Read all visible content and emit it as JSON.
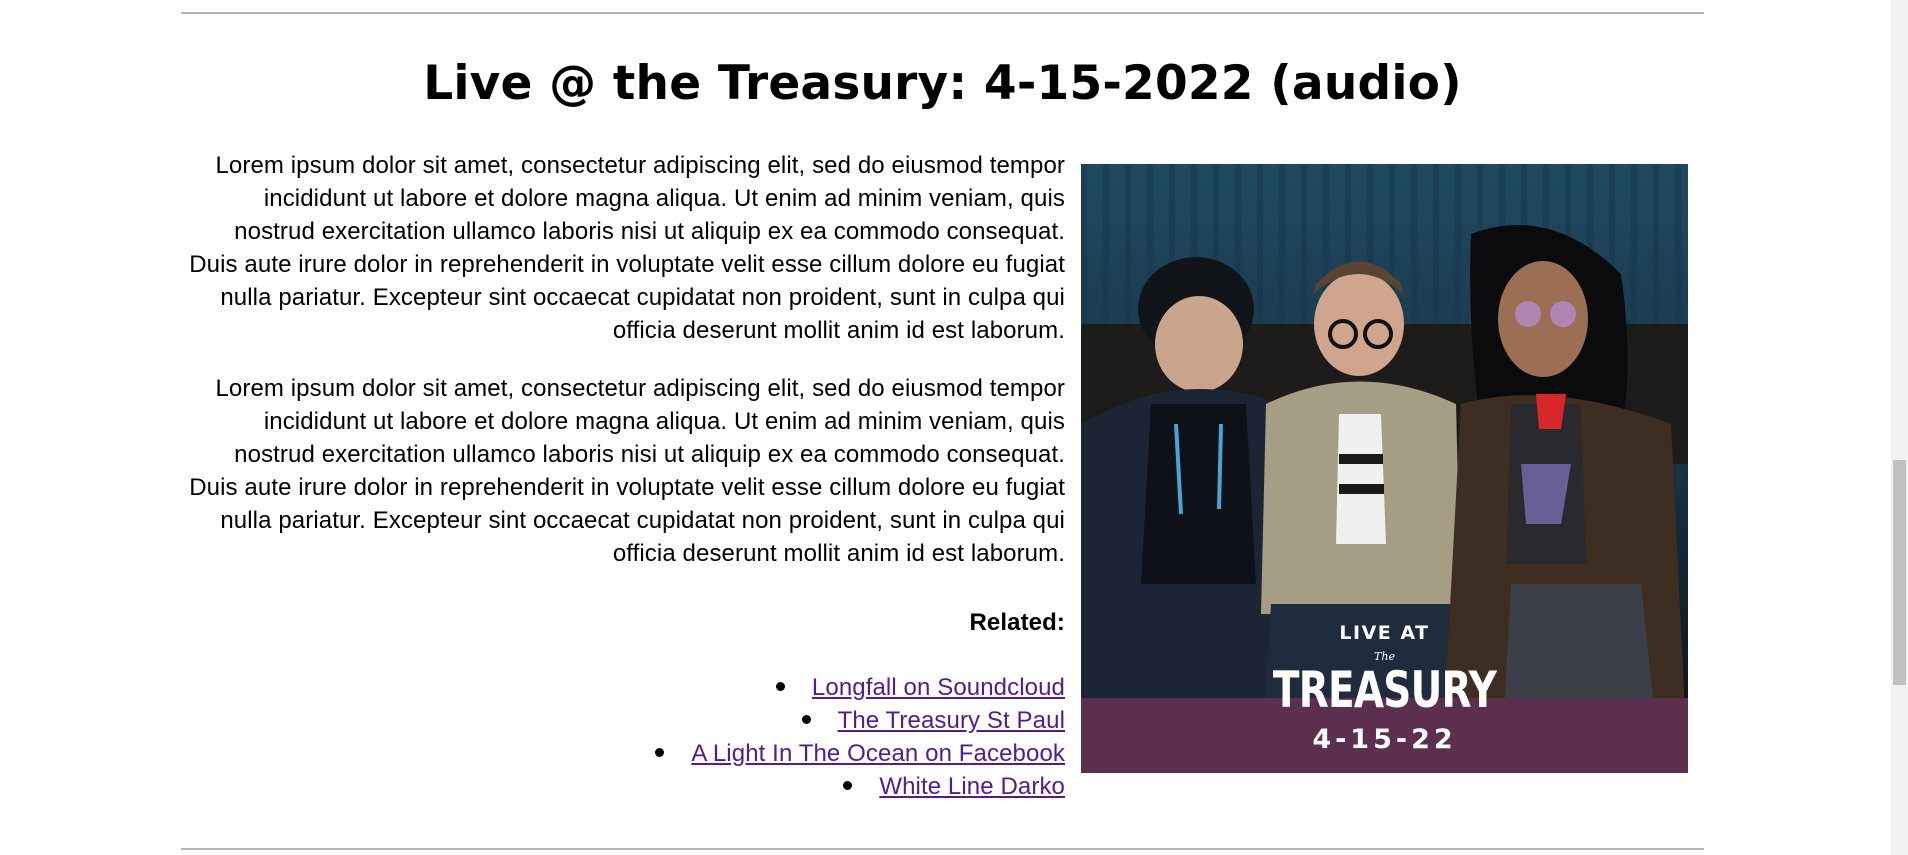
{
  "page": {
    "title": "Live @ the Treasury: 4-15-2022 (audio)",
    "paragraphs": [
      "Lorem ipsum dolor sit amet, consectetur adipiscing elit, sed do eiusmod tempor incididunt ut labore et dolore magna aliqua. Ut enim ad minim veniam, quis nostrud exercitation ullamco laboris nisi ut aliquip ex ea commodo consequat. Duis aute irure dolor in reprehenderit in voluptate velit esse cillum dolore eu fugiat nulla pariatur. Excepteur sint occaecat cupidatat non proident, sunt in culpa qui officia deserunt mollit anim id est laborum.",
      "Lorem ipsum dolor sit amet, consectetur adipiscing elit, sed do eiusmod tempor incididunt ut labore et dolore magna aliqua. Ut enim ad minim veniam, quis nostrud exercitation ullamco laboris nisi ut aliquip ex ea commodo consequat. Duis aute irure dolor in reprehenderit in voluptate velit esse cillum dolore eu fugiat nulla pariatur. Excepteur sint occaecat cupidatat non proident, sunt in culpa qui officia deserunt mollit anim id est laborum."
    ],
    "related_heading": "Related:",
    "related_links": [
      "Longfall on Soundcloud",
      "The Treasury St Paul",
      "A Light In The Ocean on Facebook",
      "White Line Darko"
    ]
  },
  "photo": {
    "logo_line1": "LIVE AT",
    "logo_line2": "The",
    "logo_line3": "TREASURY",
    "logo_date": "4-15-22",
    "band_color": "#5b2f4d",
    "link_color": "#551a8b"
  }
}
